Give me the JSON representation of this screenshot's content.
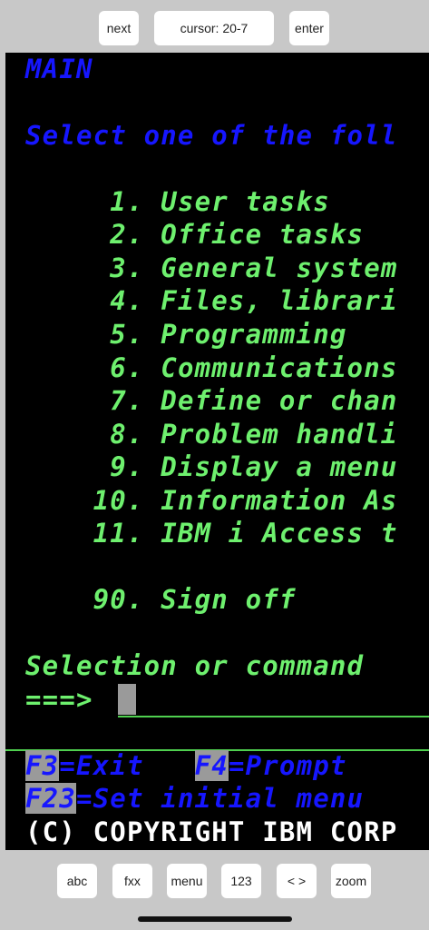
{
  "toolbar": {
    "next_label": "next",
    "cursor_label": "cursor: 20-7",
    "enter_label": "enter"
  },
  "terminal": {
    "screen_name": "MAIN",
    "instruction": "Select one of the foll",
    "menu_items": [
      {
        "number": "     1.",
        "text": " User tasks"
      },
      {
        "number": "     2.",
        "text": " Office tasks"
      },
      {
        "number": "     3.",
        "text": " General system"
      },
      {
        "number": "     4.",
        "text": " Files, librari"
      },
      {
        "number": "     5.",
        "text": " Programming"
      },
      {
        "number": "     6.",
        "text": " Communications"
      },
      {
        "number": "     7.",
        "text": " Define or chan"
      },
      {
        "number": "     8.",
        "text": " Problem handli"
      },
      {
        "number": "     9.",
        "text": " Display a menu"
      },
      {
        "number": "    10.",
        "text": " Information As"
      },
      {
        "number": "    11.",
        "text": " IBM i Access t"
      }
    ],
    "signoff": {
      "number": "    90.",
      "text": " Sign off"
    },
    "prompt_label": "Selection or command",
    "prompt_arrow": "===>",
    "fkeys_line1": [
      {
        "key": "F3",
        "label": "=Exit"
      },
      {
        "key": "F4",
        "label": "=Prompt"
      }
    ],
    "fkeys_line2": [
      {
        "key": "F23",
        "label": "=Set initial menu"
      }
    ],
    "copyright": "(C) COPYRIGHT IBM CORP"
  },
  "bottombar": {
    "abc": "abc",
    "fxx": "fxx",
    "menu": "menu",
    "num": "123",
    "arrows": "< >",
    "zoom": "zoom"
  },
  "colors": {
    "terminal_bg": "#000000",
    "blue_text": "#1616ff",
    "green_text": "#6ef06e",
    "white_text": "#ffffff",
    "fkey_highlight": "#9a9a9a"
  }
}
